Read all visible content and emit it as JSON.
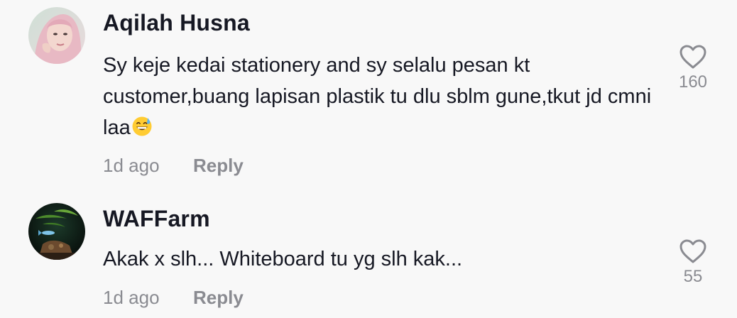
{
  "comments": [
    {
      "author": "Aqilah Husna",
      "text": "Sy keje kedai stationery and sy selalu pesan kt customer,buang lapisan plastik tu dlu sblm gune,tkut jd cmni laa",
      "emoji_icon": "grinning-face-with-sweat-icon",
      "time": "1d ago",
      "reply_label": "Reply",
      "likes": "160"
    },
    {
      "author": "WAFFarm",
      "text": "Akak x slh... Whiteboard tu yg slh kak...",
      "time": "1d ago",
      "reply_label": "Reply",
      "likes": "55"
    }
  ],
  "colors": {
    "background": "#f8f8f8",
    "primary_text": "#161823",
    "secondary_text": "#8a8b91"
  }
}
